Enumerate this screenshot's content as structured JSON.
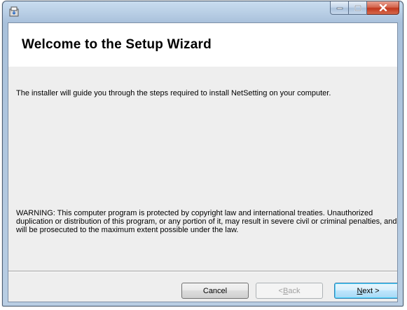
{
  "window": {
    "icon": "installer-package-icon",
    "title": ""
  },
  "caption_buttons": {
    "minimize_icon": "minimize-icon",
    "maximize_icon": "maximize-icon",
    "close_icon": "close-icon"
  },
  "banner": {
    "title": "Welcome to the Setup Wizard"
  },
  "content": {
    "intro": "The installer will guide you through the steps required to install NetSetting on your computer.",
    "warning": "WARNING: This computer program is protected by copyright law and international treaties. Unauthorized duplication or distribution of this program, or any portion of it, may result in severe civil or criminal penalties, and will be prosecuted to the maximum extent possible under the law."
  },
  "buttons": {
    "cancel": "Cancel",
    "back_prefix": "< ",
    "back_hotkey": "B",
    "back_rest": "ack",
    "back_enabled": false,
    "next_hotkey": "N",
    "next_rest": "ext >"
  },
  "colors": {
    "close_button": "#c1371d",
    "next_button_border": "#3c7fb1",
    "banner_background": "#ffffff",
    "client_background": "#eeeeee"
  }
}
